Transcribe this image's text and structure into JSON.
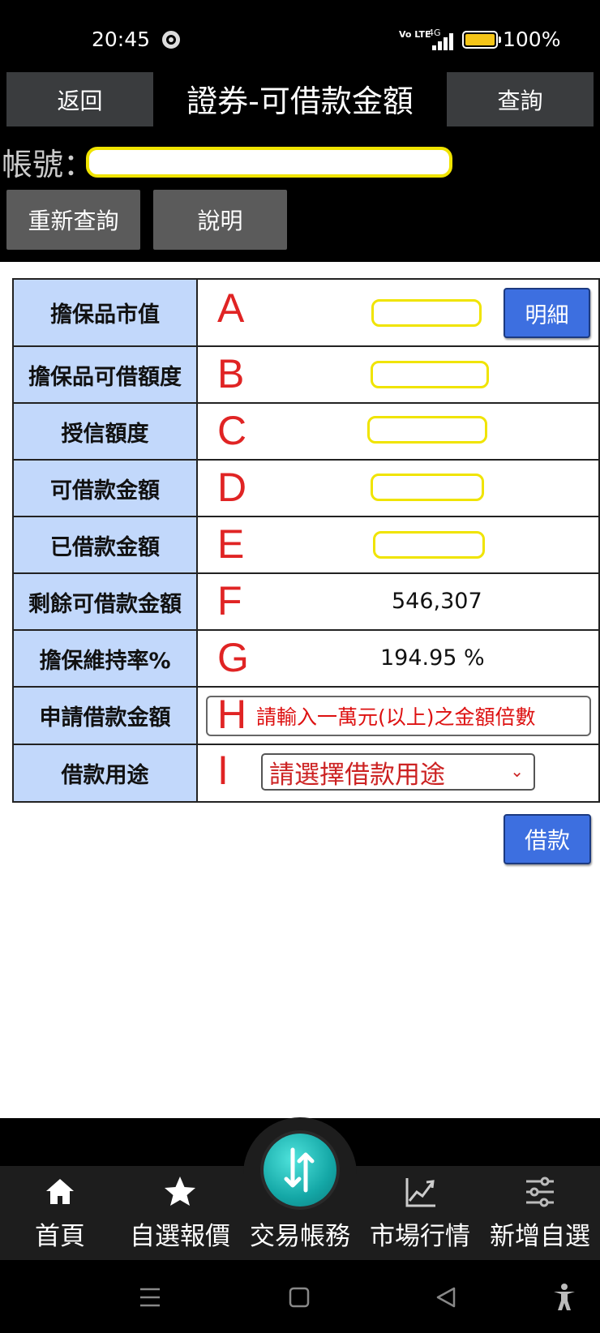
{
  "status_bar": {
    "time": "20:45",
    "network": "4G",
    "volte": "Vo LTE",
    "battery_level": 1.0,
    "battery_pct": "100%"
  },
  "header": {
    "back_label": "返回",
    "title": "證券-可借款金額",
    "query_label": "查詢"
  },
  "account": {
    "label": "帳號：",
    "value": ""
  },
  "actions": {
    "requery_label": "重新查詢",
    "help_label": "說明"
  },
  "rows": [
    {
      "label": "擔保品市值",
      "letter": "A",
      "value": "",
      "button": "明細"
    },
    {
      "label": "擔保品可借額度",
      "letter": "B",
      "value": ""
    },
    {
      "label": "授信額度",
      "letter": "C",
      "value": ""
    },
    {
      "label": "可借款金額",
      "letter": "D",
      "value": ""
    },
    {
      "label": "已借款金額",
      "letter": "E",
      "value": ""
    },
    {
      "label": "剩餘可借款金額",
      "letter": "F",
      "value": "546,307"
    },
    {
      "label": "擔保維持率%",
      "letter": "G",
      "value": "194.95 %"
    },
    {
      "label": "申請借款金額",
      "letter": "H",
      "placeholder": "請輸入一萬元(以上)之金額倍數"
    },
    {
      "label": "借款用途",
      "letter": "I",
      "selected": "請選擇借款用途"
    }
  ],
  "borrow_label": "借款",
  "nav": {
    "items": [
      {
        "label": "首頁",
        "icon": "home-icon"
      },
      {
        "label": "自選報價",
        "icon": "star-icon"
      },
      {
        "label": "交易帳務",
        "icon": "transfer-icon"
      },
      {
        "label": "市場行情",
        "icon": "chart-icon"
      },
      {
        "label": "新增自選",
        "icon": "sliders-icon"
      }
    ]
  },
  "colors": {
    "label_cell_bg": "#c2d8fb",
    "letter_red": "#e02424",
    "button_blue": "#3d6fe0",
    "highlight_yellow": "#f0e400",
    "nav_center": "#14a7a6"
  }
}
